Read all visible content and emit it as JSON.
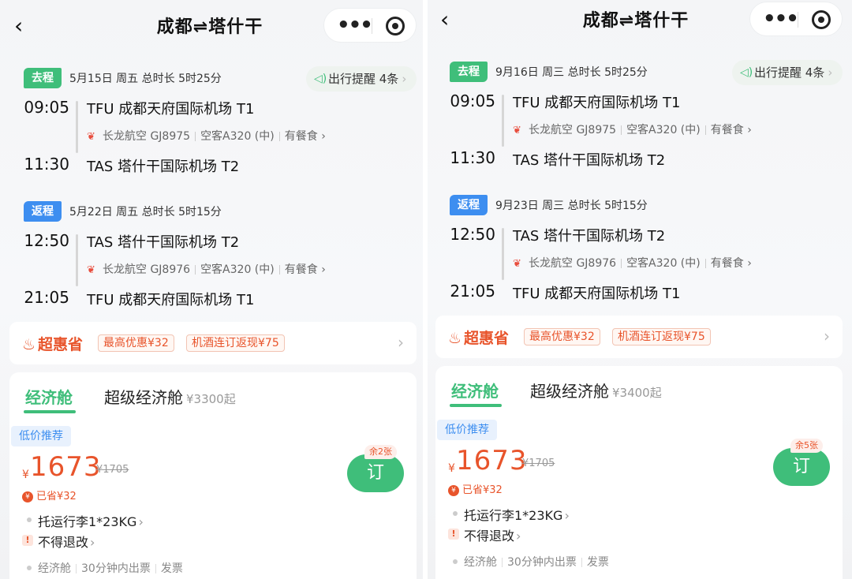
{
  "panels": [
    {
      "title": "成都⇌塔什干",
      "outbound": {
        "tag": "去程",
        "meta": "5月15日  周五   总时长 5时25分",
        "reminder": "出行提醒 4条",
        "dep_time": "09:05",
        "dep_airport": "TFU 成都天府国际机场 T1",
        "airline": "长龙航空 GJ8975",
        "aircraft": "空客A320 (中)",
        "meal": "有餐食",
        "arr_time": "11:30",
        "arr_airport": "TAS 塔什干国际机场 T2"
      },
      "inbound": {
        "tag": "返程",
        "meta": "5月22日  周五   总时长 5时15分",
        "dep_time": "12:50",
        "dep_airport": "TAS 塔什干国际机场 T2",
        "airline": "长龙航空 GJ8976",
        "aircraft": "空客A320 (中)",
        "meal": "有餐食",
        "arr_time": "21:05",
        "arr_airport": "TFU 成都天府国际机场 T1"
      },
      "promo": {
        "brand": "超惠省",
        "tag1": "最高优惠¥32",
        "tag2": "机酒连订返现¥75"
      },
      "cabin": {
        "tab1": "经济舱",
        "tab2": "超级经济舱",
        "tab2_from": "¥3300起",
        "low_tag": "低价推荐",
        "currency": "¥",
        "price": "1673",
        "orig_price": "¥1705",
        "saved": "已省¥32",
        "book": "订",
        "remaining": "余2张",
        "baggage": "托运行李1*23KG",
        "refund": "不得退改",
        "footer_class": "经济舱",
        "footer_issue": "30分钟内出票",
        "footer_invoice": "发票"
      }
    },
    {
      "title": "成都⇌塔什干",
      "outbound": {
        "tag": "去程",
        "meta": "9月16日  周三   总时长 5时25分",
        "reminder": "出行提醒 4条",
        "dep_time": "09:05",
        "dep_airport": "TFU 成都天府国际机场 T1",
        "airline": "长龙航空 GJ8975",
        "aircraft": "空客A320 (中)",
        "meal": "有餐食",
        "arr_time": "11:30",
        "arr_airport": "TAS 塔什干国际机场 T2"
      },
      "inbound": {
        "tag": "返程",
        "meta": "9月23日  周三   总时长 5时15分",
        "dep_time": "12:50",
        "dep_airport": "TAS 塔什干国际机场 T2",
        "airline": "长龙航空 GJ8976",
        "aircraft": "空客A320 (中)",
        "meal": "有餐食",
        "arr_time": "21:05",
        "arr_airport": "TFU 成都天府国际机场 T1"
      },
      "promo": {
        "brand": "超惠省",
        "tag1": "最高优惠¥32",
        "tag2": "机酒连订返现¥75"
      },
      "cabin": {
        "tab1": "经济舱",
        "tab2": "超级经济舱",
        "tab2_from": "¥3400起",
        "low_tag": "低价推荐",
        "currency": "¥",
        "price": "1673",
        "orig_price": "¥1705",
        "saved": "已省¥32",
        "book": "订",
        "remaining": "余5张",
        "baggage": "托运行李1*23KG",
        "refund": "不得退改",
        "footer_class": "经济舱",
        "footer_issue": "30分钟内出票",
        "footer_invoice": "发票"
      }
    }
  ],
  "icons": {
    "back": "chevron-left-icon",
    "more": "more-dots-icon",
    "close": "target-close-icon",
    "speaker": "speaker-icon",
    "airline_logo": "airline-logo-icon",
    "flame": "flame-icon",
    "coin": "coin-icon",
    "warning": "warning-icon"
  },
  "colors": {
    "green": "#3fbe7a",
    "blue": "#3d8ef0",
    "orange": "#e8542b"
  }
}
